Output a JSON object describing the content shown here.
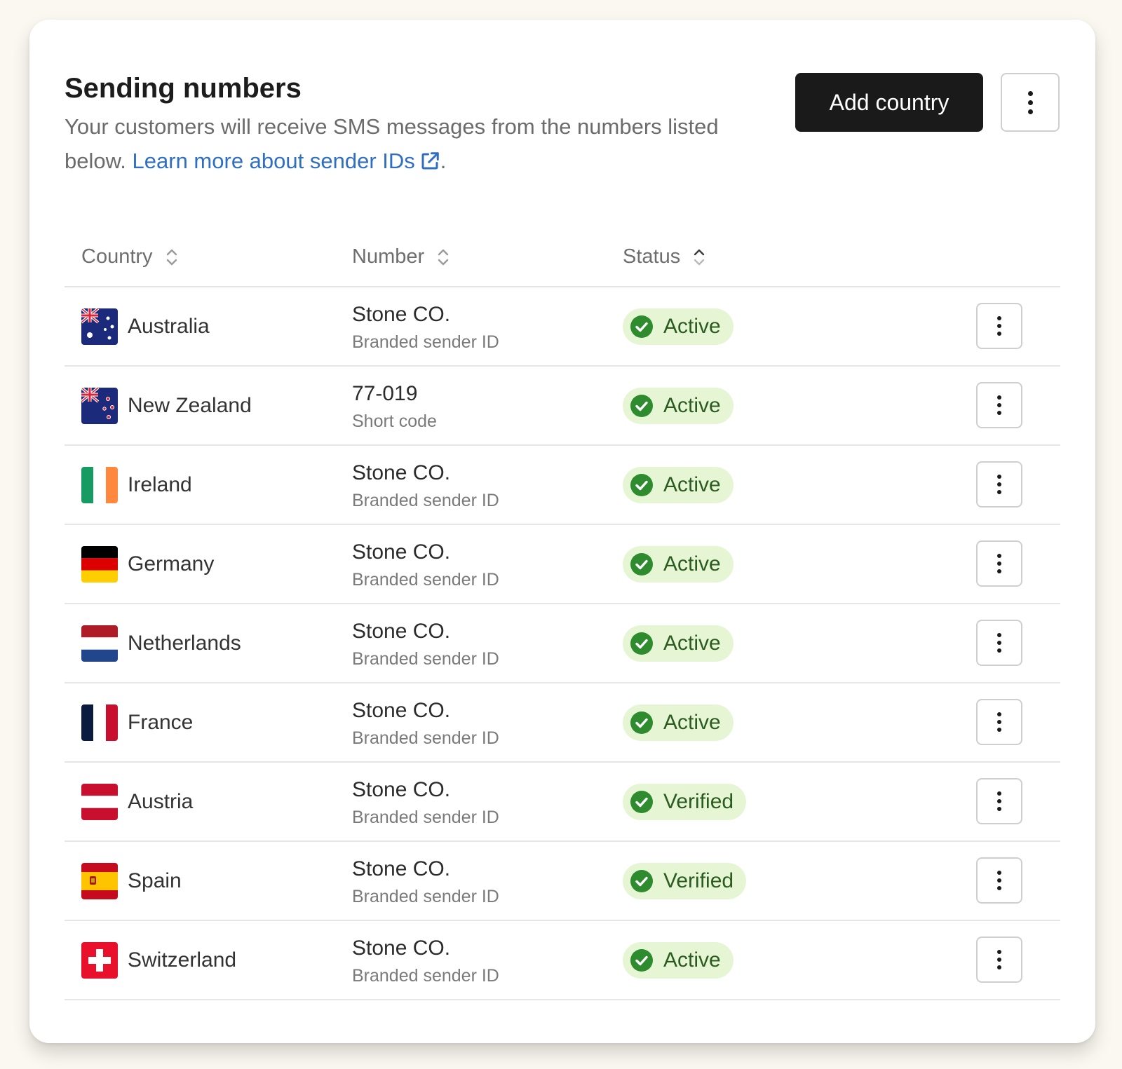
{
  "header": {
    "title": "Sending numbers",
    "description": "Your customers will receive SMS messages from the numbers listed below.",
    "link_text": "Learn more about sender IDs",
    "link_suffix": ".",
    "add_button": "Add country"
  },
  "table": {
    "columns": [
      "Country",
      "Number",
      "Status"
    ],
    "rows": [
      {
        "country": "Australia",
        "flag": "australia-flag",
        "number": "Stone CO.",
        "type": "Branded sender ID",
        "status": "Active"
      },
      {
        "country": "New Zealand",
        "flag": "new-zealand-flag",
        "number": "77-019",
        "type": "Short code",
        "status": "Active"
      },
      {
        "country": "Ireland",
        "flag": "ireland-flag",
        "number": "Stone CO.",
        "type": "Branded sender ID",
        "status": "Active"
      },
      {
        "country": "Germany",
        "flag": "germany-flag",
        "number": "Stone CO.",
        "type": "Branded sender ID",
        "status": "Active"
      },
      {
        "country": "Netherlands",
        "flag": "netherlands-flag",
        "number": "Stone CO.",
        "type": "Branded sender ID",
        "status": "Active"
      },
      {
        "country": "France",
        "flag": "france-flag",
        "number": "Stone CO.",
        "type": "Branded sender ID",
        "status": "Active"
      },
      {
        "country": "Austria",
        "flag": "austria-flag",
        "number": "Stone CO.",
        "type": "Branded sender ID",
        "status": "Verified"
      },
      {
        "country": "Spain",
        "flag": "spain-flag",
        "number": "Stone CO.",
        "type": "Branded sender ID",
        "status": "Verified"
      },
      {
        "country": "Switzerland",
        "flag": "switzerland-flag",
        "number": "Stone CO.",
        "type": "Branded sender ID",
        "status": "Active"
      }
    ]
  },
  "colors": {
    "primary_button": "#1a1a1a",
    "link": "#2f6fc2",
    "status_bg": "#e6f6d4",
    "status_check": "#2e8b2e"
  }
}
